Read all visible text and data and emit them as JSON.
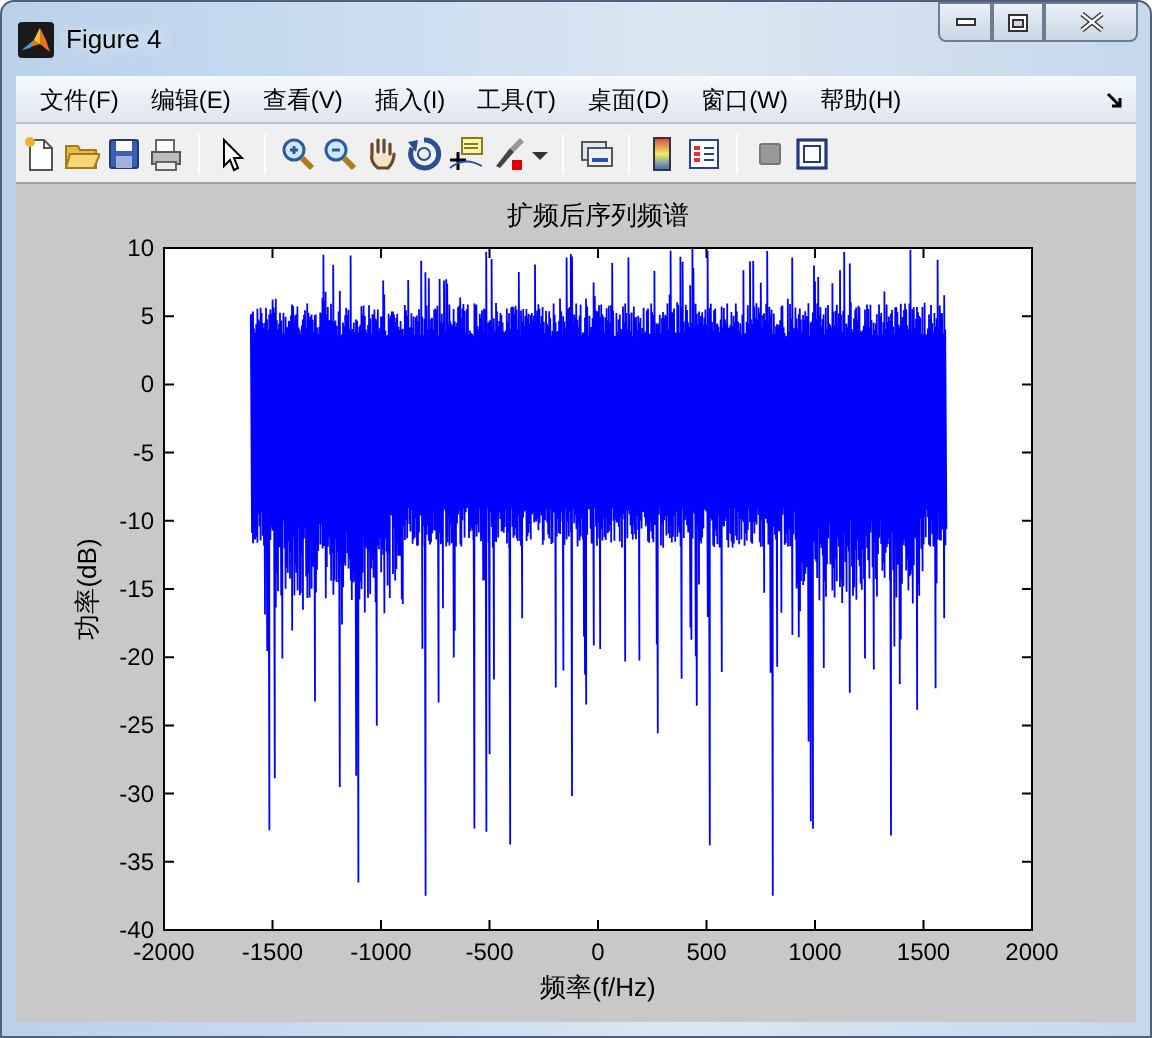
{
  "window": {
    "title": "Figure 4"
  },
  "menu": [
    {
      "label": "文件(F)"
    },
    {
      "label": "编辑(E)"
    },
    {
      "label": "查看(V)"
    },
    {
      "label": "插入(I)"
    },
    {
      "label": "工具(T)"
    },
    {
      "label": "桌面(D)"
    },
    {
      "label": "窗口(W)"
    },
    {
      "label": "帮助(H)"
    }
  ],
  "figure": {
    "title": "扩频后序列频谱",
    "xlabel": "频率(f/Hz)",
    "ylabel": "功率(dB)",
    "xticks": [
      "-2000",
      "-1500",
      "-1000",
      "-500",
      "0",
      "500",
      "1000",
      "1500",
      "2000"
    ],
    "yticks": [
      "10",
      "5",
      "0",
      "-5",
      "-10",
      "-15",
      "-20",
      "-25",
      "-30",
      "-35",
      "-40"
    ]
  }
}
